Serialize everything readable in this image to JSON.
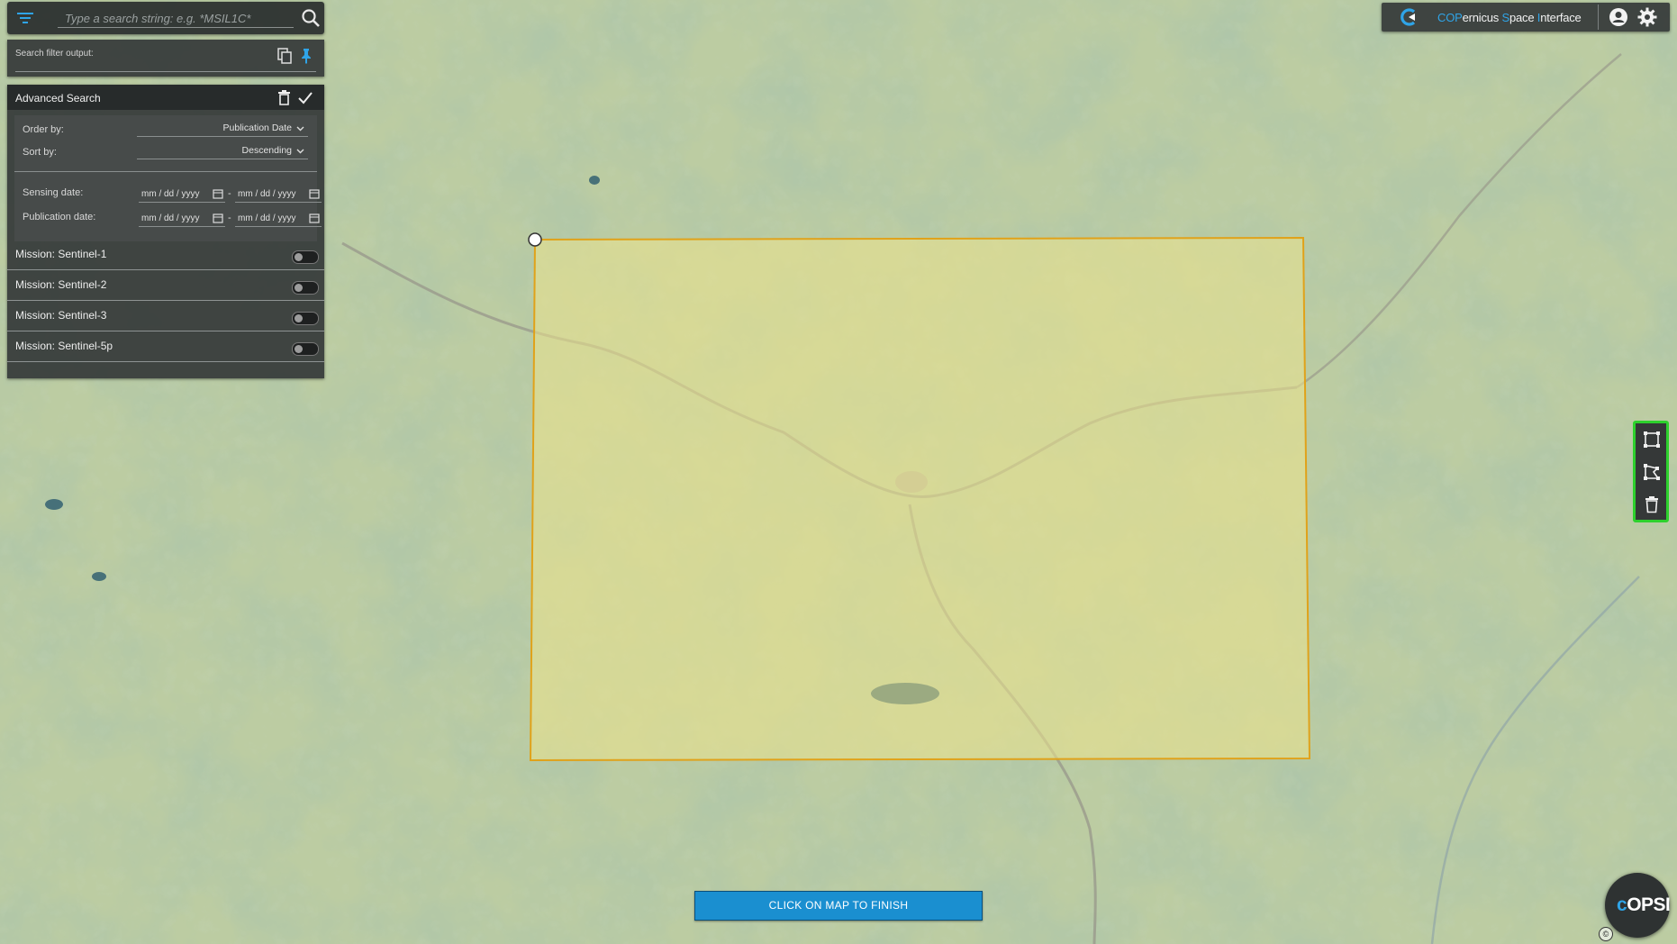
{
  "search": {
    "placeholder": "Type a search string: e.g. *MSIL1C*"
  },
  "filter_output": {
    "label": "Search filter output:"
  },
  "advanced_search": {
    "title": "Advanced Search",
    "order_by_label": "Order by:",
    "order_by_value": "Publication Date",
    "sort_by_label": "Sort by:",
    "sort_by_value": "Descending",
    "sensing_date_label": "Sensing date:",
    "publication_date_label": "Publication date:",
    "date_placeholder": "mm / dd / yyyy",
    "date_separator": "-",
    "missions": [
      {
        "label": "Mission: Sentinel-1",
        "enabled": false
      },
      {
        "label": "Mission: Sentinel-2",
        "enabled": false
      },
      {
        "label": "Mission: Sentinel-3",
        "enabled": false
      },
      {
        "label": "Mission: Sentinel-5p",
        "enabled": false
      }
    ]
  },
  "header": {
    "title_parts": [
      "COP",
      "ernicus ",
      "S",
      "pace ",
      "I",
      "nterface"
    ]
  },
  "draw_tools": {
    "icons": [
      "rectangle-draw-icon",
      "polygon-draw-icon",
      "trash-icon"
    ]
  },
  "finish_button": {
    "label": "CLICK ON MAP TO FINISH"
  },
  "badge": {
    "text_c": "c",
    "text_rest": "OPSI",
    "copyright": "©"
  },
  "colors": {
    "accent": "#2fa4e7",
    "selection_fill": "#e8df8a",
    "selection_stroke": "#e0a21a",
    "tools_highlight": "#2dd12d",
    "button": "#1a8fd0"
  }
}
